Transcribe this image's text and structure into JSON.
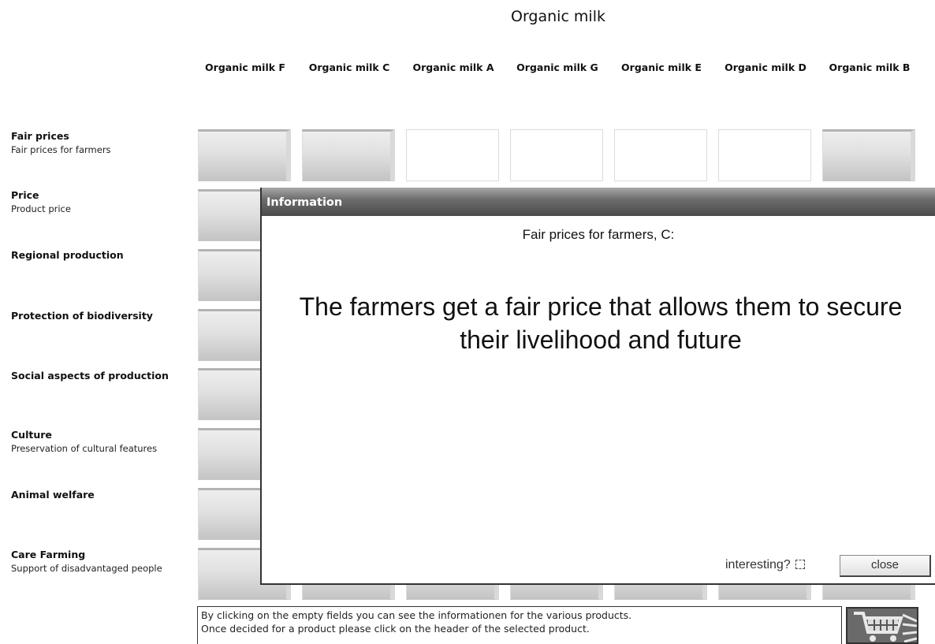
{
  "title": "Organic milk",
  "products": [
    "Organic milk F",
    "Organic milk C",
    "Organic milk A",
    "Organic milk G",
    "Organic milk E",
    "Organic milk D",
    "Organic milk B"
  ],
  "criteria": [
    {
      "title": "Fair prices",
      "subtitle": "Fair prices for farmers"
    },
    {
      "title": "Price",
      "subtitle": "Product price"
    },
    {
      "title": "Regional production",
      "subtitle": ""
    },
    {
      "title": "Protection of biodiversity",
      "subtitle": ""
    },
    {
      "title": "Social aspects of production",
      "subtitle": ""
    },
    {
      "title": "Culture",
      "subtitle": "Preservation of cultural features"
    },
    {
      "title": "Animal welfare",
      "subtitle": ""
    },
    {
      "title": "Care Farming",
      "subtitle": "Support of disadvantaged people"
    }
  ],
  "fair_prices_row_state": [
    "filled",
    "filled",
    "empty",
    "empty",
    "empty",
    "empty",
    "filled"
  ],
  "instructions": {
    "line1": "By clicking on the empty fields you can see the informationen for the various products.",
    "line2": "Once decided for a product please click on the header of the selected product."
  },
  "dialog": {
    "title": "Information",
    "heading": "Fair prices for farmers, C:",
    "body": "The farmers get a fair price that allows them to secure their livelihood and future",
    "interesting_label": "interesting?",
    "close_label": "close"
  },
  "icons": {
    "cart": "shopping-cart-icon"
  }
}
